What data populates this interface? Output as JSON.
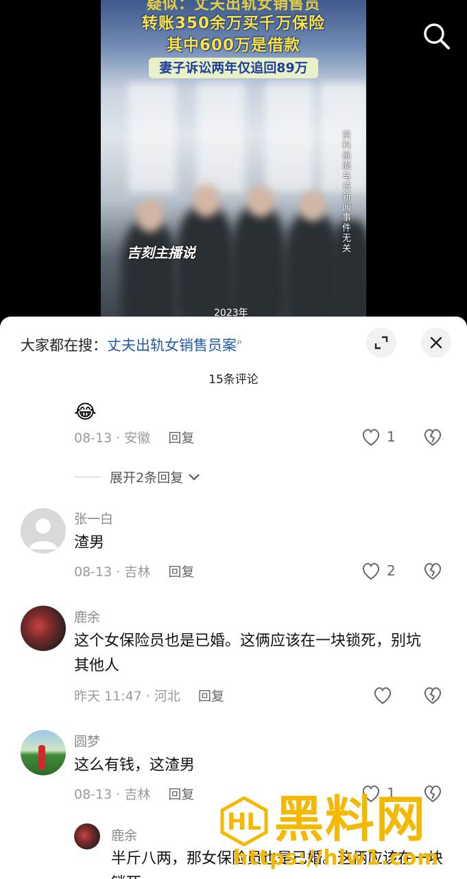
{
  "video": {
    "headline_top": "疑似：丈夫出轨女销售员",
    "headline_1": "转账350余万买千万保险",
    "headline_2": "其中600万是借款",
    "headline_3": "妻子诉讼两年仅追回89万",
    "disclaimer": "资料画面与该新闻事件无关",
    "brand": "吉刻主播说",
    "year": "2023年"
  },
  "sheet": {
    "search_prefix": "大家都在搜：",
    "search_keyword": "丈夫出轨女销售员案",
    "comment_count": "15条评论",
    "expand_label": "展开2条回复"
  },
  "comments": [
    {
      "emoji": "😂",
      "date": "08-13",
      "location": "安徽",
      "reply": "回复",
      "likes": "1"
    },
    {
      "name": "张一白",
      "text": "渣男",
      "date": "08-13",
      "location": "吉林",
      "reply": "回复",
      "likes": "2"
    },
    {
      "name": "鹿余",
      "text": "这个女保险员也是已婚。这俩应该在一块锁死，别坑其他人",
      "date": "昨天 11:47",
      "location": "河北",
      "reply": "回复",
      "likes": ""
    },
    {
      "name": "圆梦",
      "text": "这么有钱，这渣男",
      "date": "08-13",
      "location": "吉林",
      "reply": "回复",
      "likes": "1"
    }
  ],
  "sub_reply": {
    "name": "鹿余",
    "text": "半斤八两，那女保险员也是已婚。这俩应该在一块锁死"
  },
  "overlay": {
    "site": "黑料网",
    "url": "https://hlw1.com"
  },
  "colors": {
    "link": "#1e5aa8",
    "accent": "#f5b800",
    "sheet_bg": "#ffffff"
  }
}
